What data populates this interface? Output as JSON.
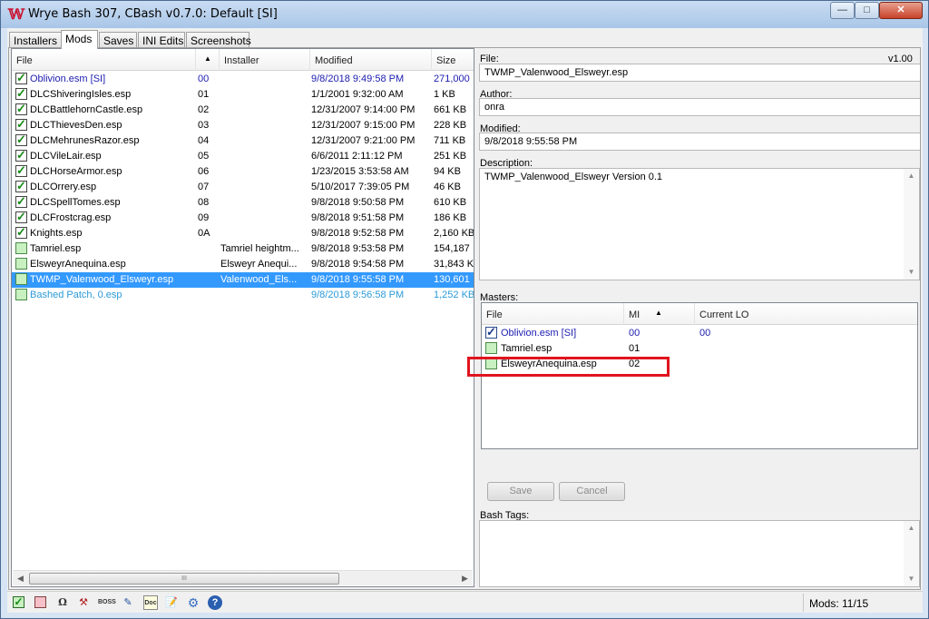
{
  "window": {
    "title": "Wrye Bash 307, CBash v0.7.0: Default [SI]",
    "minimize": "—",
    "maximize": "□",
    "close": "✕"
  },
  "tabs": [
    "Installers",
    "Mods",
    "Saves",
    "INI Edits",
    "Screenshots"
  ],
  "modlist": {
    "columns": [
      "File",
      "Installer",
      "Modified",
      "Size"
    ],
    "sort_indicator": "▲",
    "rows": [
      {
        "file": "Oblivion.esm [SI]",
        "order": "00",
        "installer": "",
        "modified": "9/8/2018 9:49:58 PM",
        "size": "271,000",
        "checked": true,
        "style": "blue"
      },
      {
        "file": "DLCShiveringIsles.esp",
        "order": "01",
        "installer": "",
        "modified": "1/1/2001 9:32:00 AM",
        "size": "1 KB",
        "checked": true,
        "style": "normal"
      },
      {
        "file": "DLCBattlehornCastle.esp",
        "order": "02",
        "installer": "",
        "modified": "12/31/2007 9:14:00 PM",
        "size": "661 KB",
        "checked": true,
        "style": "normal"
      },
      {
        "file": "DLCThievesDen.esp",
        "order": "03",
        "installer": "",
        "modified": "12/31/2007 9:15:00 PM",
        "size": "228 KB",
        "checked": true,
        "style": "normal"
      },
      {
        "file": "DLCMehrunesRazor.esp",
        "order": "04",
        "installer": "",
        "modified": "12/31/2007 9:21:00 PM",
        "size": "711 KB",
        "checked": true,
        "style": "normal"
      },
      {
        "file": "DLCVileLair.esp",
        "order": "05",
        "installer": "",
        "modified": "6/6/2011 2:11:12 PM",
        "size": "251 KB",
        "checked": true,
        "style": "normal"
      },
      {
        "file": "DLCHorseArmor.esp",
        "order": "06",
        "installer": "",
        "modified": "1/23/2015 3:53:58 AM",
        "size": "94 KB",
        "checked": true,
        "style": "normal"
      },
      {
        "file": "DLCOrrery.esp",
        "order": "07",
        "installer": "",
        "modified": "5/10/2017 7:39:05 PM",
        "size": "46 KB",
        "checked": true,
        "style": "normal"
      },
      {
        "file": "DLCSpellTomes.esp",
        "order": "08",
        "installer": "",
        "modified": "9/8/2018 9:50:58 PM",
        "size": "610 KB",
        "checked": true,
        "style": "normal"
      },
      {
        "file": "DLCFrostcrag.esp",
        "order": "09",
        "installer": "",
        "modified": "9/8/2018 9:51:58 PM",
        "size": "186 KB",
        "checked": true,
        "style": "normal"
      },
      {
        "file": "Knights.esp",
        "order": "0A",
        "installer": "",
        "modified": "9/8/2018 9:52:58 PM",
        "size": "2,160 KB",
        "checked": true,
        "style": "normal"
      },
      {
        "file": "Tamriel.esp",
        "order": "",
        "installer": "Tamriel heightm...",
        "modified": "9/8/2018 9:53:58 PM",
        "size": "154,187",
        "checked": false,
        "style": "normal"
      },
      {
        "file": "ElsweyrAnequina.esp",
        "order": "",
        "installer": "Elsweyr Anequi...",
        "modified": "9/8/2018 9:54:58 PM",
        "size": "31,843 K",
        "checked": false,
        "style": "normal"
      },
      {
        "file": "TWMP_Valenwood_Elsweyr.esp",
        "order": "",
        "installer": "Valenwood_Els...",
        "modified": "9/8/2018 9:55:58 PM",
        "size": "130,601",
        "checked": false,
        "style": "selected"
      },
      {
        "file": "Bashed Patch, 0.esp",
        "order": "",
        "installer": "",
        "modified": "9/8/2018 9:56:58 PM",
        "size": "1,252 KB",
        "checked": false,
        "style": "lightblue"
      }
    ],
    "scroll_left": "◀",
    "scroll_right": "▶",
    "thumb_grip": "III"
  },
  "details": {
    "file_label": "File:",
    "version": "v1.00",
    "file_value": "TWMP_Valenwood_Elsweyr.esp",
    "author_label": "Author:",
    "author_value": "onra",
    "modified_label": "Modified:",
    "modified_value": "9/8/2018 9:55:58 PM",
    "description_label": "Description:",
    "description_value": "TWMP_Valenwood_Elsweyr Version 0.1",
    "masters_label": "Masters:",
    "masters_columns": [
      "File",
      "MI",
      "Current LO"
    ],
    "masters_sort_indicator": "▲",
    "masters": [
      {
        "file": "Oblivion.esm [SI]",
        "mi": "00",
        "current_lo": "00",
        "checked": true,
        "style": "blue"
      },
      {
        "file": "Tamriel.esp",
        "mi": "01",
        "current_lo": "",
        "checked": false,
        "style": "normal"
      },
      {
        "file": "ElsweyrAnequina.esp",
        "mi": "02",
        "current_lo": "",
        "checked": false,
        "style": "normal"
      }
    ],
    "save_button": "Save",
    "cancel_button": "Cancel",
    "bash_tags_label": "Bash Tags:"
  },
  "statusbar": {
    "icons": [
      "checkbox-icon",
      "pink-square-icon",
      "oblivion-icon",
      "wrench-icon",
      "boss-icon",
      "paint-icon",
      "doc-icon",
      "notepad-icon",
      "gear-icon",
      "help-icon"
    ],
    "boss_text": "BOSS",
    "doc_text": "Doc",
    "help_text": "?",
    "mods_count": "Mods: 11/15"
  },
  "colors": {
    "selected_row": "#3399ff",
    "active_text_blue": "#1c1cb0",
    "bashed_patch_blue": "#2b9ad8",
    "highlight_box": "#e0141e"
  }
}
